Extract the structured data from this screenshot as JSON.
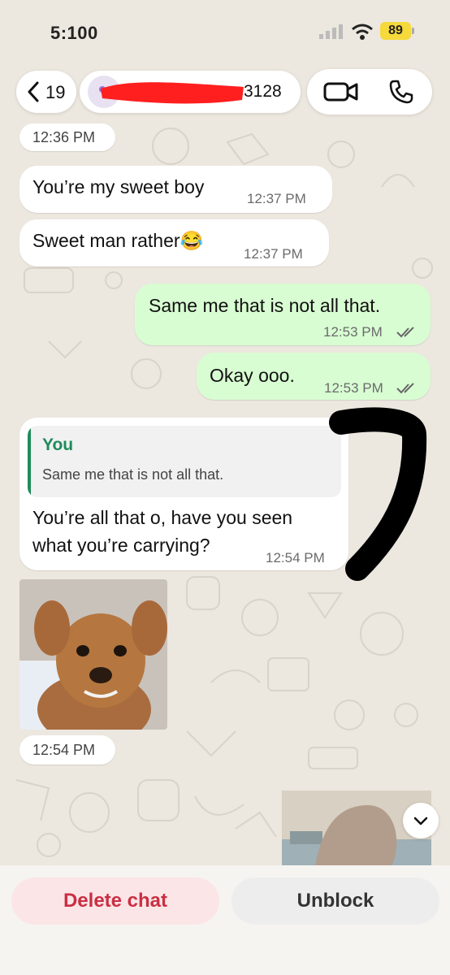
{
  "status_bar": {
    "time": "5:100",
    "battery": "89"
  },
  "header": {
    "back_count": "19",
    "contact_name_visible": "3128"
  },
  "messages": [
    {
      "kind": "time",
      "time": "12:36 PM"
    },
    {
      "kind": "incoming",
      "text": "You’re my sweet boy",
      "time": "12:37 PM"
    },
    {
      "kind": "incoming",
      "text": "Sweet man rather😂",
      "time": "12:37 PM"
    },
    {
      "kind": "outgoing",
      "text": "Same me that is not all that.",
      "time": "12:53 PM",
      "status": "read"
    },
    {
      "kind": "outgoing",
      "text": "Okay ooo.",
      "time": "12:53 PM",
      "status": "read"
    },
    {
      "kind": "incoming_reply",
      "quote_author": "You",
      "quote_text": "Same me that is not all that.",
      "text_line1": "You’re all that o, have you seen",
      "text_line2": "what you’re carrying?",
      "time": "12:54 PM"
    },
    {
      "kind": "image",
      "time": "12:54 PM"
    }
  ],
  "bottom_bar": {
    "delete_label": "Delete chat",
    "unblock_label": "Unblock"
  },
  "colors": {
    "outgoing_bubble": "#d8fdd2",
    "incoming_bubble": "#ffffff",
    "quote_accent": "#1e8c5a",
    "delete_text": "#c92f43",
    "battery": "#f6d93b",
    "redaction": "#ff1f1f",
    "annotation_marker": "#000000"
  },
  "icons": {
    "back": "chevron-left-icon",
    "video": "video-camera-icon",
    "phone": "phone-icon",
    "scroll": "chevron-down-icon",
    "read_receipt": "double-check-icon"
  }
}
